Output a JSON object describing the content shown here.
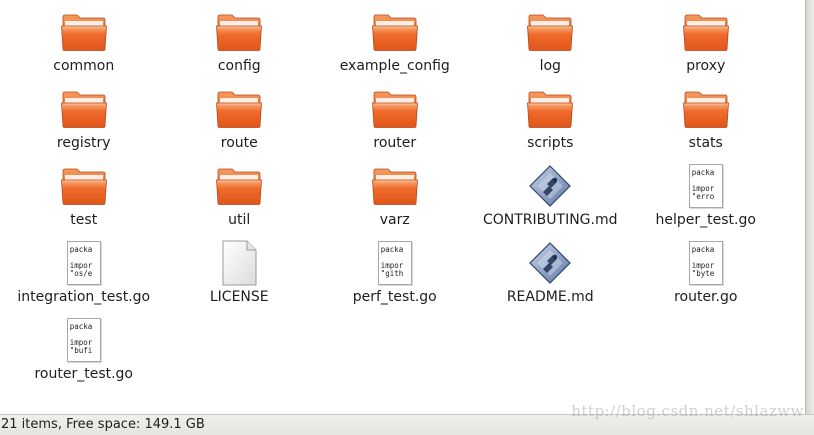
{
  "colors": {
    "folder_light": "#f59a5e",
    "folder_dark": "#e0561c",
    "folder_front": "#ef6a2b"
  },
  "items": [
    {
      "name": "common",
      "type": "folder"
    },
    {
      "name": "config",
      "type": "folder"
    },
    {
      "name": "example_config",
      "type": "folder"
    },
    {
      "name": "log",
      "type": "folder"
    },
    {
      "name": "proxy",
      "type": "folder"
    },
    {
      "name": "registry",
      "type": "folder"
    },
    {
      "name": "route",
      "type": "folder"
    },
    {
      "name": "router",
      "type": "folder"
    },
    {
      "name": "scripts",
      "type": "folder"
    },
    {
      "name": "stats",
      "type": "folder"
    },
    {
      "name": "test",
      "type": "folder"
    },
    {
      "name": "util",
      "type": "folder"
    },
    {
      "name": "varz",
      "type": "folder"
    },
    {
      "name": "CONTRIBUTING.md",
      "type": "markdown"
    },
    {
      "name": "helper_test.go",
      "type": "text",
      "preview": [
        "packa",
        "",
        "impor",
        "\"erro"
      ]
    },
    {
      "name": "integration_test.go",
      "type": "text",
      "preview": [
        "packa",
        "",
        "impor",
        "\"os/e"
      ]
    },
    {
      "name": "LICENSE",
      "type": "blank"
    },
    {
      "name": "perf_test.go",
      "type": "text",
      "preview": [
        "packa",
        "",
        "impor",
        "\"gith"
      ]
    },
    {
      "name": "README.md",
      "type": "markdown"
    },
    {
      "name": "router.go",
      "type": "text",
      "preview": [
        "packa",
        "",
        "impor",
        "\"byte"
      ]
    },
    {
      "name": "router_test.go",
      "type": "text",
      "preview": [
        "packa",
        "",
        "impor",
        "\"bufi"
      ]
    }
  ],
  "statusbar": {
    "text": "21 items, Free space: 149.1 GB"
  },
  "watermark": "http://blog.csdn.net/shlazww"
}
